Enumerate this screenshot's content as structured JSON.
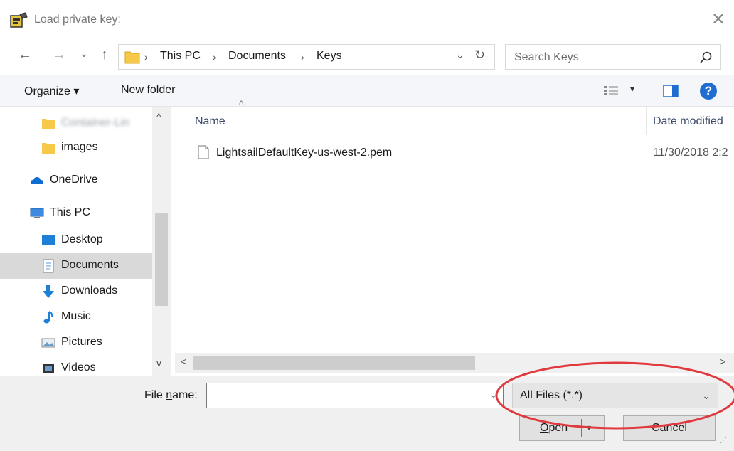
{
  "window": {
    "title": "Load private key:",
    "close_glyph": "✕",
    "icon": "key-app-icon"
  },
  "nav": {
    "back_glyph": "←",
    "forward_glyph": "→",
    "recent_glyph": "⌄",
    "up_glyph": "↑",
    "breadcrumb": [
      "This PC",
      "Documents",
      "Keys"
    ],
    "separator": "›",
    "dropdown_glyph": "⌄",
    "refresh_glyph": "↻"
  },
  "search": {
    "placeholder": "Search Keys"
  },
  "toolbar": {
    "organize_label": "Organize ▾",
    "new_folder_label": "New folder",
    "view_dropdown_glyph": "▾",
    "help_glyph": "?"
  },
  "sidebar": {
    "items": [
      {
        "label": "Container-Lin",
        "icon": "folder-icon",
        "blurred": true
      },
      {
        "label": "images",
        "icon": "folder-icon"
      },
      {
        "label": "OneDrive",
        "icon": "cloud-icon"
      },
      {
        "label": "This PC",
        "icon": "computer-icon"
      },
      {
        "label": "Desktop",
        "icon": "desktop-icon"
      },
      {
        "label": "Documents",
        "icon": "documents-icon",
        "selected": true
      },
      {
        "label": "Downloads",
        "icon": "download-icon"
      },
      {
        "label": "Music",
        "icon": "music-icon"
      },
      {
        "label": "Pictures",
        "icon": "pictures-icon"
      },
      {
        "label": "Videos",
        "icon": "videos-icon"
      }
    ],
    "scroll_up": "^",
    "scroll_down": "v"
  },
  "file_list": {
    "columns": [
      "Name",
      "Date modified"
    ],
    "sort_glyph": "^",
    "rows": [
      {
        "name": "LightsailDefaultKey-us-west-2.pem",
        "date": "11/30/2018 2:2"
      }
    ],
    "hscroll_left": "<",
    "hscroll_right": ">"
  },
  "footer": {
    "file_name_label_pre": "File ",
    "file_name_label_key": "n",
    "file_name_label_post": "ame:",
    "file_name_value": "",
    "file_name_dd": "⌄",
    "filter_value": "All Files (*.*)",
    "filter_dd": "⌄",
    "open_key": "O",
    "open_rest": "pen",
    "open_arrow": "▾",
    "cancel_label": "Cancel"
  },
  "colors": {
    "accent": "#1f6dd1",
    "highlight_ellipse": "#e0393e",
    "selected_bg": "#d9d9d9"
  }
}
